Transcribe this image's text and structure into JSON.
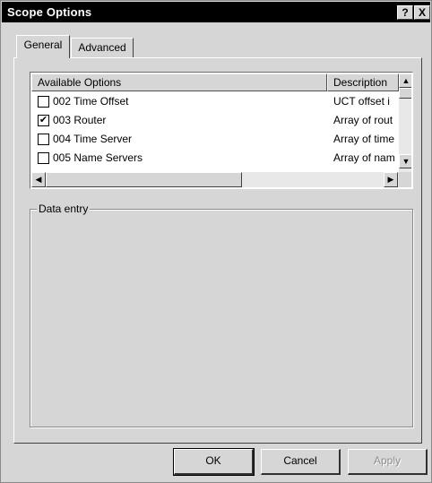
{
  "window": {
    "title": "Scope Options",
    "help_glyph": "?",
    "close_glyph": "X"
  },
  "tabs": [
    {
      "label": "General",
      "selected": true
    },
    {
      "label": "Advanced",
      "selected": false
    }
  ],
  "options_list": {
    "columns": [
      "Available Options",
      "Description"
    ],
    "rows": [
      {
        "label": "002 Time Offset",
        "description": "UCT offset i",
        "checked": false
      },
      {
        "label": "003 Router",
        "description": "Array of rout",
        "checked": true
      },
      {
        "label": "004 Time Server",
        "description": "Array of time",
        "checked": false
      },
      {
        "label": "005 Name Servers",
        "description": "Array of nam",
        "checked": false
      }
    ]
  },
  "data_entry": {
    "label": "Data entry"
  },
  "buttons": {
    "ok": "OK",
    "cancel": "Cancel",
    "apply": "Apply"
  },
  "glyphs": {
    "check": "✔",
    "up": "▲",
    "down": "▼",
    "left": "◀",
    "right": "▶"
  }
}
